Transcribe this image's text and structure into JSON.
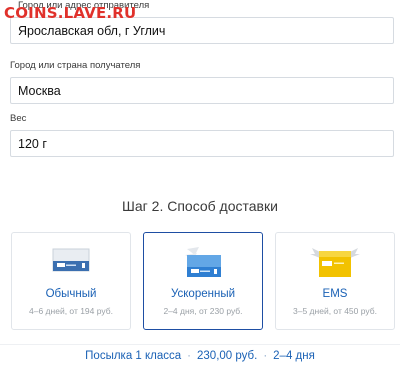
{
  "watermark": "COINS.LAVE.RU",
  "from": {
    "label": "Город или адрес отправителя",
    "value": "Ярославская обл, г Углич"
  },
  "to": {
    "label": "Город или страна получателя",
    "value": "Москва"
  },
  "weight": {
    "label": "Вес",
    "value": "120 г"
  },
  "step": {
    "title": "Шаг 2. Способ доставки"
  },
  "options": [
    {
      "name": "Обычный",
      "sub": "4–6 дней, от 194 руб.",
      "icon": "standard-envelope-icon",
      "selected": false
    },
    {
      "name": "Ускоренный",
      "sub": "2–4 дня, от 230 руб.",
      "icon": "express-envelope-icon",
      "selected": true
    },
    {
      "name": "EMS",
      "sub": "3–5 дней, от 450 руб.",
      "icon": "ems-package-icon",
      "selected": false
    }
  ],
  "summary": {
    "service": "Посылка 1 класса",
    "price": "230,00 руб.",
    "term": "2–4 дня"
  },
  "colors": {
    "accent": "#1a61b5",
    "selected_border": "#1e4ea3",
    "ems_yellow": "#f2c200",
    "watermark": "#e0312b"
  }
}
